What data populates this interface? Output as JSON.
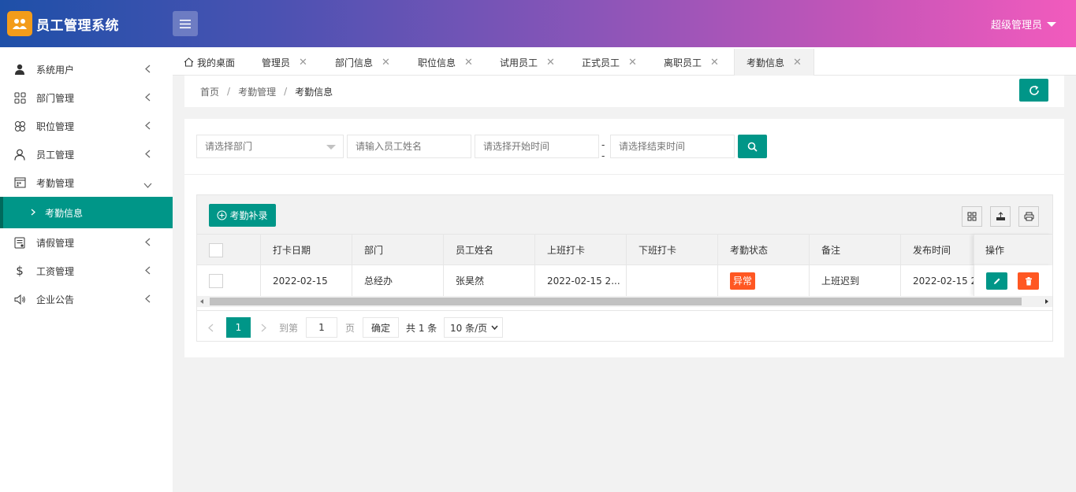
{
  "app": {
    "title": "员工管理系统"
  },
  "header": {
    "user": "超级管理员"
  },
  "sidebar": {
    "items": [
      {
        "label": "系统用户",
        "icon": "user-icon"
      },
      {
        "label": "部门管理",
        "icon": "grid-icon"
      },
      {
        "label": "职位管理",
        "icon": "clover-icon"
      },
      {
        "label": "员工管理",
        "icon": "person-outline-icon"
      },
      {
        "label": "考勤管理",
        "icon": "calendar-icon"
      },
      {
        "label": "请假管理",
        "icon": "form-icon"
      },
      {
        "label": "工资管理",
        "icon": "dollar-icon"
      },
      {
        "label": "企业公告",
        "icon": "speaker-icon"
      }
    ],
    "active_sub": "考勤信息"
  },
  "tabs": {
    "items": [
      {
        "label": "我的桌面"
      },
      {
        "label": "管理员"
      },
      {
        "label": "部门信息"
      },
      {
        "label": "职位信息"
      },
      {
        "label": "试用员工"
      },
      {
        "label": "正式员工"
      },
      {
        "label": "离职员工"
      },
      {
        "label": "考勤信息"
      }
    ],
    "active": "考勤信息"
  },
  "breadcrumb": {
    "items": [
      "首页",
      "考勤管理",
      "考勤信息"
    ],
    "separator": "/"
  },
  "filters": {
    "department_placeholder": "请选择部门",
    "name_placeholder": "请输入员工姓名",
    "start_placeholder": "请选择开始时间",
    "end_placeholder": "请选择结束时间",
    "range_sep": "--"
  },
  "toolbar": {
    "add_label": "考勤补录"
  },
  "table": {
    "headers": [
      "打卡日期",
      "部门",
      "员工姓名",
      "上班打卡",
      "下班打卡",
      "考勤状态",
      "备注",
      "发布时间",
      "操作"
    ],
    "rows": [
      {
        "date": "2022-02-15",
        "dept": "总经办",
        "name": "张昊然",
        "checkin": "2022-02-15 2...",
        "checkout": "",
        "status": "异常",
        "remark": "上班迟到",
        "published": "2022-02-15 2..."
      }
    ]
  },
  "pagination": {
    "current": "1",
    "goto_label": "到第",
    "page_input": "1",
    "page_unit": "页",
    "confirm": "确定",
    "total": "共 1 条",
    "size": "10 条/页"
  },
  "colors": {
    "primary": "#009688",
    "danger": "#ff5722",
    "logo": "#f39c1a"
  }
}
